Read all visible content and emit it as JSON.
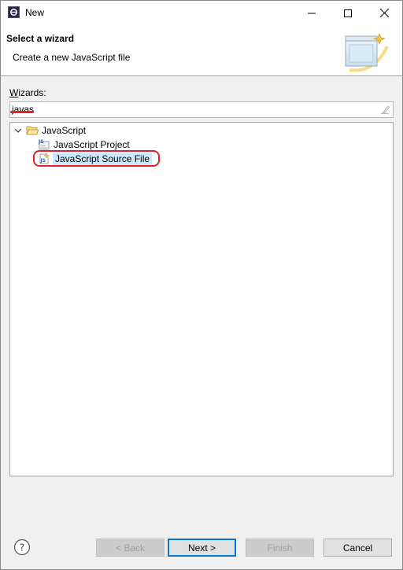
{
  "window": {
    "title": "New"
  },
  "banner": {
    "title": "Select a wizard",
    "subtitle": "Create a new JavaScript file"
  },
  "wizards": {
    "label_mnemonic": "W",
    "label_rest": "izards:",
    "filter_value": "javas"
  },
  "tree": {
    "folder": {
      "label": "JavaScript",
      "expanded": true,
      "icon": "folder-open-icon"
    },
    "items": [
      {
        "label": "JavaScript Project",
        "icon": "js-project-icon",
        "selected": false
      },
      {
        "label": "JavaScript Source File",
        "icon": "js-file-icon",
        "selected": true
      }
    ]
  },
  "buttons": {
    "back": "< Back",
    "next": "Next >",
    "finish": "Finish",
    "cancel": "Cancel"
  },
  "colors": {
    "annotation_red": "#e0202a",
    "selection_blue": "#cce8ff",
    "focus_blue": "#0078d7"
  }
}
